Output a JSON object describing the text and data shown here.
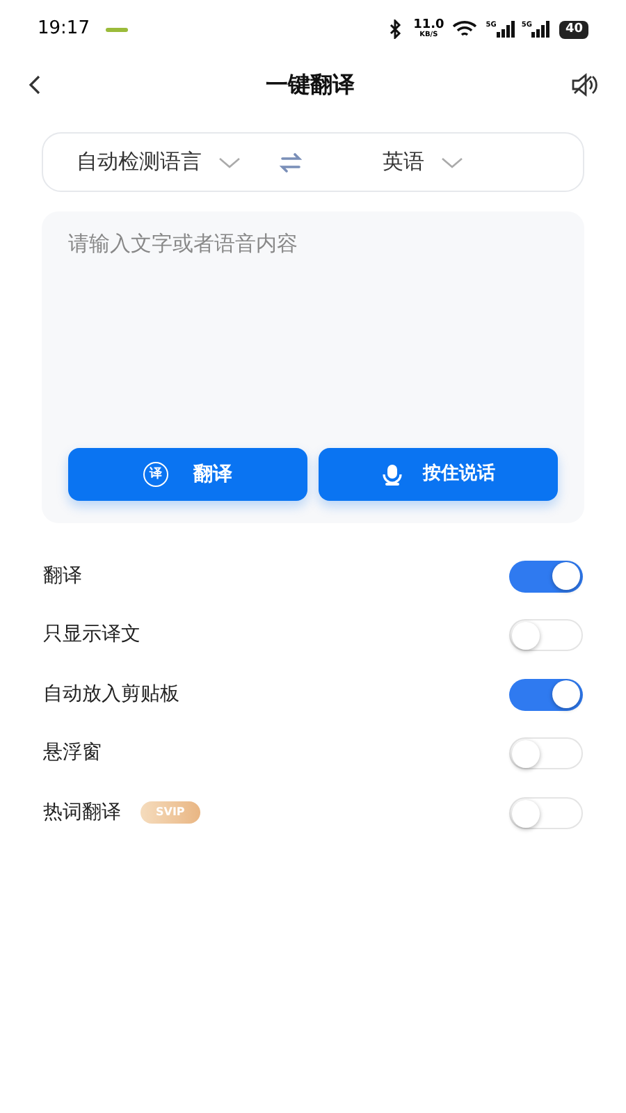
{
  "status_bar": {
    "time": "19:17",
    "speed": "11.0",
    "speed_unit": "KB/S",
    "networks": [
      "5G",
      "5G"
    ],
    "battery": "40"
  },
  "header": {
    "title": "一键翻译"
  },
  "languages": {
    "source": "自动检测语言",
    "target": "英语"
  },
  "input": {
    "placeholder": "请输入文字或者语音内容"
  },
  "buttons": [
    {
      "kind": "translate",
      "icon_char": "译",
      "label": "翻译"
    },
    {
      "kind": "voice",
      "label": "按住说话"
    }
  ],
  "settings": [
    {
      "label": "翻译",
      "on": true
    },
    {
      "label": "只显示译文",
      "on": false
    },
    {
      "label": "自动放入剪贴板",
      "on": true
    },
    {
      "label": "悬浮窗",
      "on": false
    },
    {
      "label": "热词翻译",
      "badge": "SVIP",
      "on": false
    }
  ]
}
